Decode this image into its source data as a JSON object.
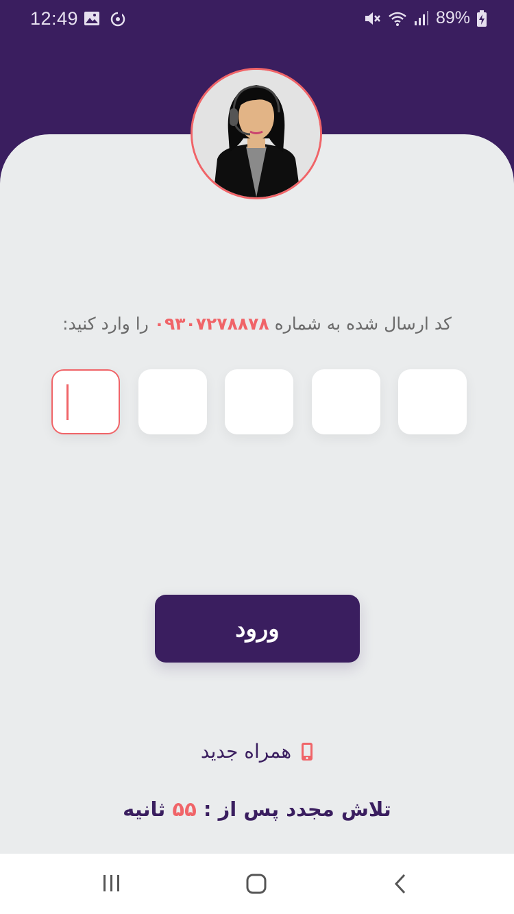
{
  "status_bar": {
    "time": "12:49",
    "battery": "89%",
    "icons": [
      "gallery-icon",
      "sync-icon",
      "mute-icon",
      "wifi-icon",
      "signal-icon",
      "battery-charging-icon"
    ]
  },
  "avatar": {
    "icon": "support-agent-avatar"
  },
  "prompt": {
    "before": "کد ارسال شده به شماره ",
    "phone": "۰۹۳۰۷۲۷۸۸۷۸",
    "after": " را وارد کنید:"
  },
  "otp": {
    "boxes": [
      "",
      "",
      "",
      "",
      ""
    ],
    "active_index": 0
  },
  "login_button": {
    "label": "ورود"
  },
  "new_number": {
    "label": "همراه جدید",
    "icon": "mobile-phone-icon"
  },
  "retry": {
    "prefix": "تلاش مجدد پس از :",
    "seconds": "۵۵",
    "suffix": "ثانیه"
  },
  "nav_bar": {
    "icons": [
      "recent-apps-icon",
      "home-icon",
      "back-icon"
    ]
  },
  "colors": {
    "primary": "#3a1e5f",
    "accent": "#f06468",
    "background": "#eaeced"
  }
}
